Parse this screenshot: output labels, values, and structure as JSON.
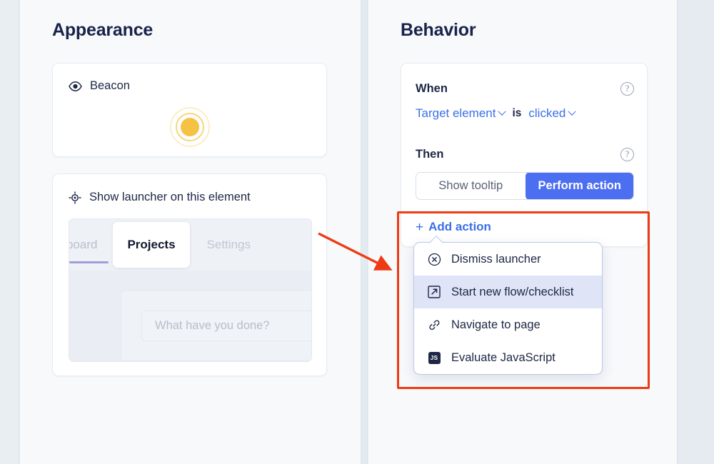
{
  "theme": {
    "accent_blue": "#3b6fe8",
    "segment_active_blue": "#4c6ef0",
    "beacon_yellow": "#f6c244",
    "annotation_red": "#ee3b15",
    "heading_navy": "#19234a",
    "menu_highlight": "#dfe5f7",
    "tab_underline_purple": "#9d9ede",
    "page_bg": "#f7f9fb"
  },
  "appearance": {
    "title": "Appearance",
    "beacon_card": {
      "icon": "eye-icon",
      "label": "Beacon",
      "preview": "beacon-dot"
    },
    "launcher_card": {
      "icon": "crosshair-target-icon",
      "label": "Show launcher on this element",
      "mock": {
        "tabs": [
          {
            "label": "shboard",
            "state": "active-underline",
            "truncated": true
          },
          {
            "label": "Projects",
            "state": "selected"
          },
          {
            "label": "Settings",
            "state": "inactive"
          }
        ],
        "input_placeholder": "What have you done?"
      }
    }
  },
  "behavior": {
    "title": "Behavior",
    "when": {
      "label": "When",
      "help": "?",
      "subject": "Target element",
      "connector": "is",
      "event": "clicked"
    },
    "then": {
      "label": "Then",
      "help": "?",
      "options": [
        {
          "label": "Show tooltip",
          "selected": false
        },
        {
          "label": "Perform action",
          "selected": true
        }
      ]
    },
    "add_action": {
      "plus": "+",
      "label": "Add action"
    },
    "action_menu": {
      "items": [
        {
          "icon": "circle-x-icon",
          "label": "Dismiss launcher",
          "highlighted": false
        },
        {
          "icon": "arrow-up-right-box-icon",
          "label": "Start new flow/checklist",
          "highlighted": true
        },
        {
          "icon": "link-chain-icon",
          "label": "Navigate to page",
          "highlighted": false
        },
        {
          "icon": "js-badge-icon",
          "label": "Evaluate JavaScript",
          "highlighted": false
        }
      ]
    }
  },
  "annotations": {
    "highlight_box": "red-rectangle-around-add-action-and-menu",
    "arrow": "red-arrow-pointing-right-to-highlight-box"
  }
}
